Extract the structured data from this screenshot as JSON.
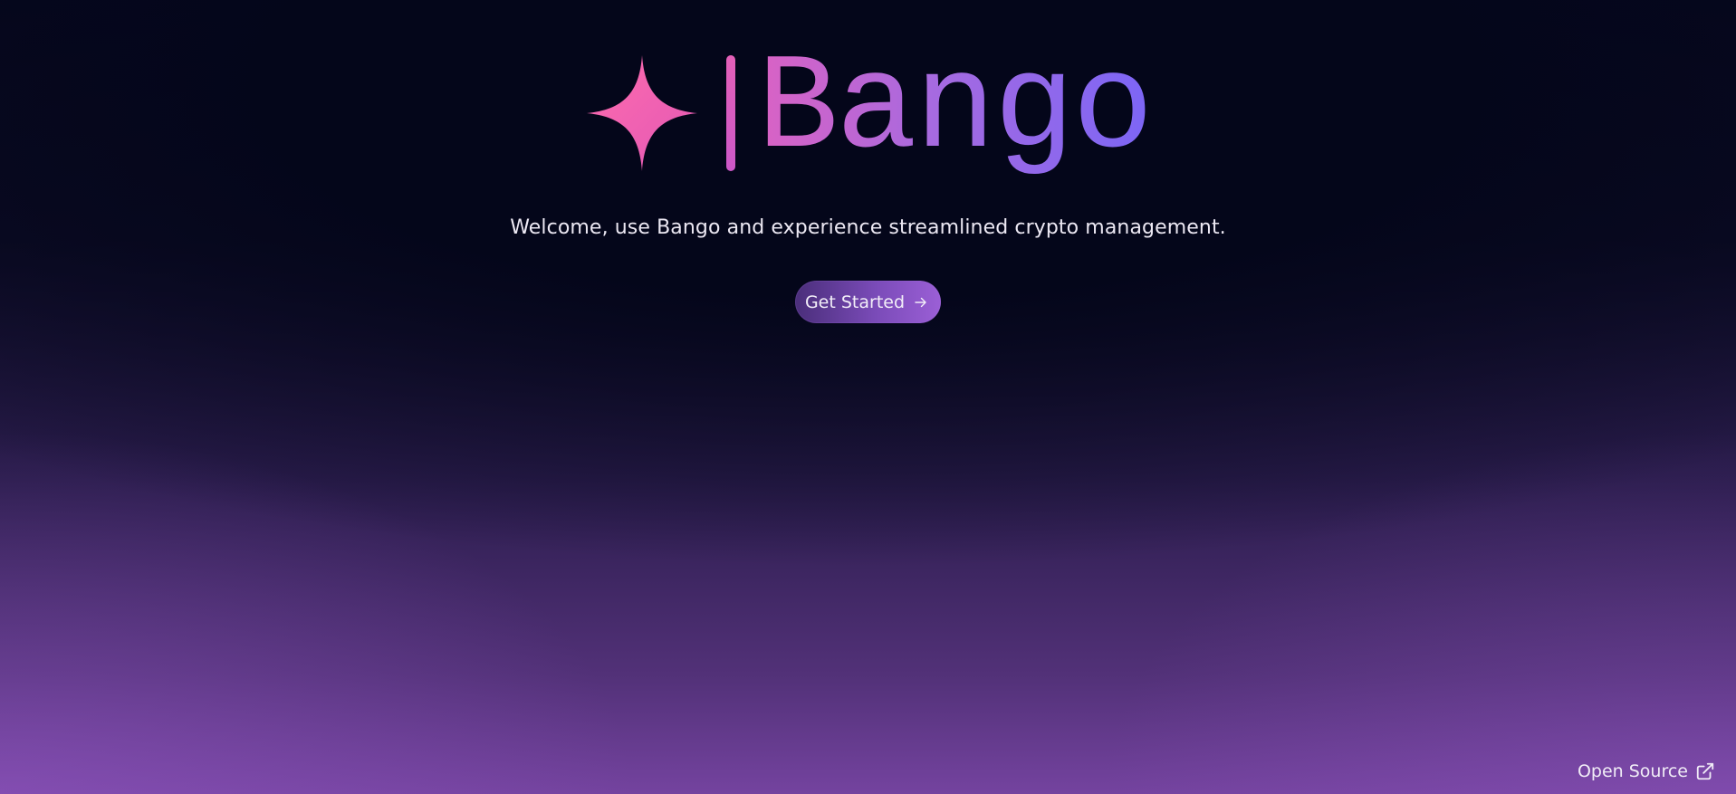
{
  "brand": {
    "name": "Bango",
    "logo_icon": "four-point-star-icon",
    "gradient_start": "#ff6cad",
    "gradient_end": "#7c66f6"
  },
  "hero": {
    "tagline": "Welcome, use Bango and experience streamlined crypto management.",
    "cta_label": "Get Started",
    "cta_icon": "arrow-right-icon"
  },
  "footer": {
    "open_source_label": "Open Source",
    "open_source_icon": "external-link-icon"
  },
  "colors": {
    "background_top": "#04061a",
    "background_bottom": "#74439f",
    "button_gradient_start": "#4a2e7a",
    "button_gradient_end": "#9b5fd6",
    "text": "#ece8f3"
  }
}
